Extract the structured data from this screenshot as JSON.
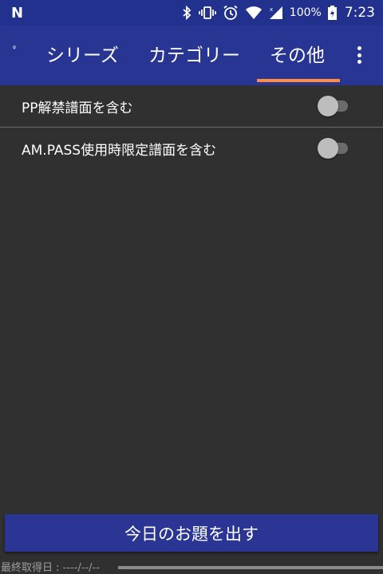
{
  "status_bar": {
    "notification_logo": "N",
    "icons": [
      "bluetooth-icon",
      "vibrate-icon",
      "alarm-icon",
      "wifi-icon",
      "cellular-signal-icon",
      "battery-charging-icon"
    ],
    "battery_percent": "100%",
    "time": "7:23"
  },
  "tabs": {
    "partial_label": "ﾟ",
    "items": [
      {
        "label": "シリーズ"
      },
      {
        "label": "カテゴリー"
      },
      {
        "label": "その他",
        "selected": true
      }
    ],
    "indicator_color": "#ff8f3c"
  },
  "settings": [
    {
      "label": "PP解禁譜面を含む",
      "enabled": false
    },
    {
      "label": "AM.PASS使用時限定譜面を含む",
      "enabled": false
    }
  ],
  "action_button": {
    "label": "今日のお題を出す"
  },
  "footer": {
    "last_fetched": "最終取得日 : ----/--/--"
  },
  "colors": {
    "primary": "#283593",
    "status_bar": "#22318e",
    "background": "#303030",
    "accent": "#ff8f3c"
  }
}
